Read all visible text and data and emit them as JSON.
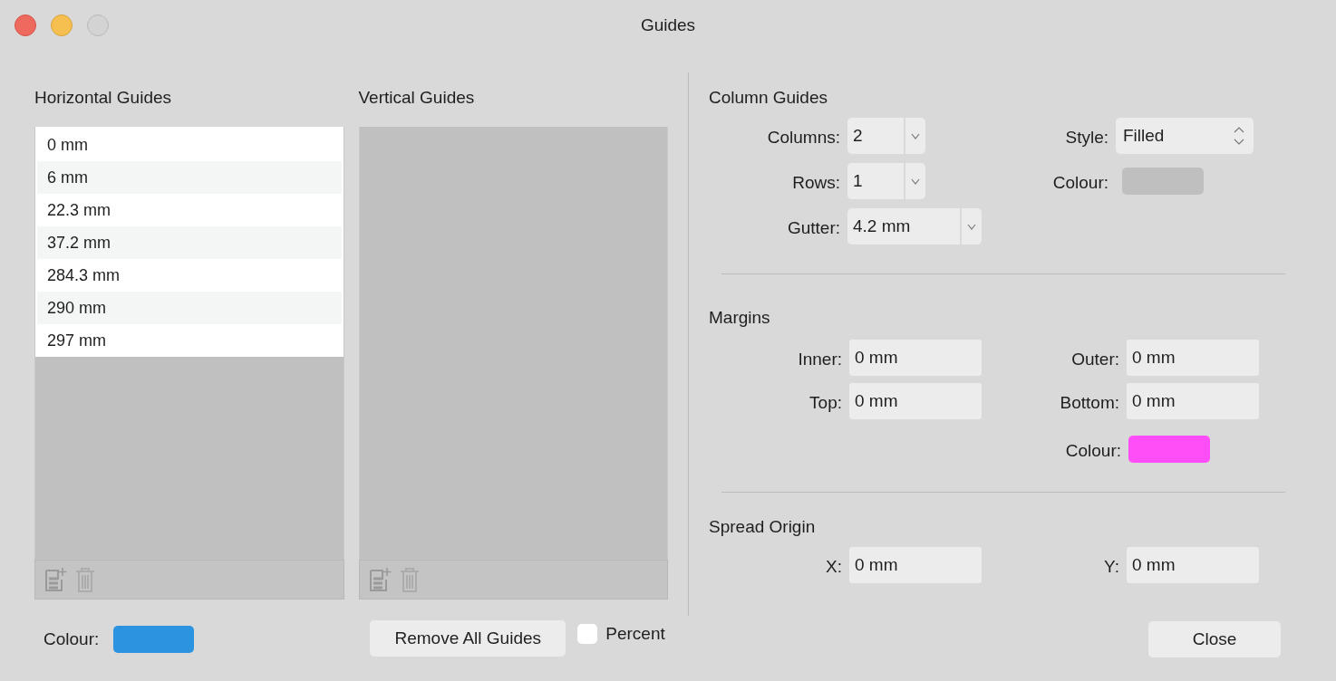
{
  "window": {
    "title": "Guides"
  },
  "horizontal_guides": {
    "heading": "Horizontal Guides",
    "items": [
      "0 mm",
      "6 mm",
      "22.3 mm",
      "37.2 mm",
      "284.3 mm",
      "290 mm",
      "297 mm"
    ]
  },
  "vertical_guides": {
    "heading": "Vertical Guides"
  },
  "guide_colour": {
    "label": "Colour:",
    "color": "#2b93df"
  },
  "remove_all_button": "Remove All Guides",
  "percent": {
    "label": "Percent",
    "checked": false
  },
  "column_guides": {
    "heading": "Column Guides",
    "columns": {
      "label": "Columns:",
      "value": "2"
    },
    "rows": {
      "label": "Rows:",
      "value": "1"
    },
    "gutter": {
      "label": "Gutter:",
      "value": "4.2 mm"
    },
    "style": {
      "label": "Style:",
      "value": "Filled"
    },
    "colour": {
      "label": "Colour:",
      "color": "#bfbfbf"
    }
  },
  "margins": {
    "heading": "Margins",
    "inner": {
      "label": "Inner:",
      "value": "0 mm"
    },
    "outer": {
      "label": "Outer:",
      "value": "0 mm"
    },
    "top": {
      "label": "Top:",
      "value": "0 mm"
    },
    "bottom": {
      "label": "Bottom:",
      "value": "0 mm"
    },
    "colour": {
      "label": "Colour:",
      "color": "#ff4ef8"
    }
  },
  "spread_origin": {
    "heading": "Spread Origin",
    "x": {
      "label": "X:",
      "value": "0 mm"
    },
    "y": {
      "label": "Y:",
      "value": "0 mm"
    }
  },
  "close_button": "Close"
}
